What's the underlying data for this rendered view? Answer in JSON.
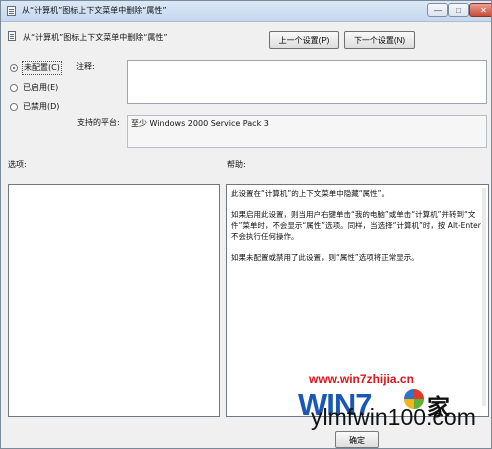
{
  "window": {
    "title": "从“计算机”图标上下文菜单中删除“属性”",
    "minimize_symbol": "—",
    "maximize_symbol": "□",
    "close_symbol": "✕"
  },
  "header": {
    "title": "从“计算机”图标上下文菜单中删除“属性”",
    "prev_button": "上一个设置(P)",
    "next_button": "下一个设置(N)"
  },
  "options": {
    "not_configured": "未配置(C)",
    "enabled": "已启用(E)",
    "disabled": "已禁用(D)",
    "selected": "not_configured"
  },
  "fields": {
    "comment_label": "注释:",
    "comment_value": "",
    "platform_label": "支持的平台:",
    "platform_value": "至少 Windows 2000 Service Pack 3"
  },
  "sections": {
    "options_label": "选项:",
    "help_label": "帮助:"
  },
  "help": {
    "paragraphs": [
      "此设置在“计算机”的上下文菜单中隐藏“属性”。",
      "如果启用此设置，则当用户右键单击“我的电脑”或单击“计算机”并转到“文件”菜单时，不会显示“属性”选项。同样，当选择“计算机”时，按 Alt-Enter 不会执行任何操作。",
      "如果未配置或禁用了此设置，则“属性”选项将正常显示。"
    ]
  },
  "buttons": {
    "ok": "确定"
  },
  "watermark": {
    "url": "www.win7zhijia.cn",
    "logo": "WIN7",
    "logo_suffix": "家",
    "site": "ylmfwin100.com"
  },
  "colors": {
    "title_gradient_top": "#dbe8f6",
    "watermark_red": "#e3141b",
    "watermark_blue": "#1b58b5"
  }
}
